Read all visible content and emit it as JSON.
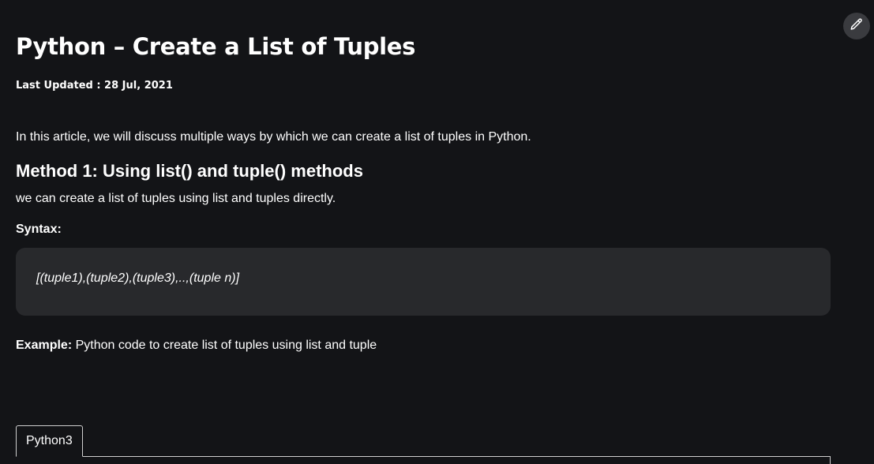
{
  "article": {
    "title": "Python – Create a List of Tuples",
    "last_updated": "Last Updated : 28 Jul, 2021",
    "intro": "In this article, we will discuss multiple ways by which we can create a list of tuples in Python.",
    "method_heading": "Method 1: Using list() and tuple() methods",
    "method_description": "we can create a list of tuples using list and tuples directly.",
    "syntax_label": "Syntax:",
    "syntax_code": "[(tuple1),(tuple2),(tuple3),..,(tuple n)]",
    "example_label": "Example:",
    "example_text": " Python code to create list of tuples using list and tuple"
  },
  "code_tabs": [
    {
      "label": "Python3",
      "active": true
    }
  ],
  "toolbar": {
    "edit_icon": "pencil-icon"
  },
  "colors": {
    "background": "#131417",
    "code_box": "#28292c",
    "edit_button": "#3a3b3f",
    "text": "#ffffff"
  }
}
